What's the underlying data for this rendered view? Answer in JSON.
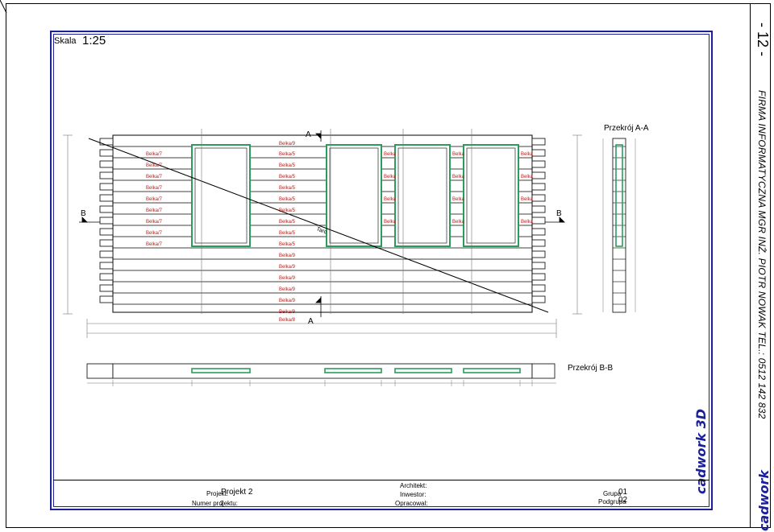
{
  "sheet": {
    "scale_label": "Skala",
    "scale_value": "1:25",
    "sheet_number": "- 12 -",
    "firm_info": "FIRMA INFORMATYCZNA MGR INŻ. PIOTR NOWAK  TEL.: 0512 142 832",
    "logo_text": "cadwork 3D",
    "logo_side_text": "cadwork"
  },
  "drawing": {
    "section_a_marker": "A",
    "section_b_marker": "B",
    "section_aa_title": "Przekrój A-A",
    "section_bb_title": "Przekrój B-B",
    "beam_labels_left": [
      "Belka/7",
      "Belka/7",
      "Belka/7",
      "Belka/7",
      "Belka/7",
      "Belka/7",
      "Belka/7",
      "Belka/7",
      "Belka/7"
    ],
    "beam_labels_center": [
      "Belka/9",
      "Belka/5",
      "Belka/5",
      "Belka/5",
      "Belka/5",
      "Belka/5",
      "Belka/5",
      "Belka/5",
      "Belka/5",
      "Belka/5",
      "Belka/9",
      "Belka/9",
      "Belka/9",
      "Belka/9",
      "Belka/9",
      "Belka/9",
      "Belka/8"
    ],
    "beam_label_small": "Belka",
    "diagonal_label": "Tarc"
  },
  "title_block": {
    "project_label": "Projekt:",
    "project_value": "Projekt 2",
    "project_number_label": "Numer projektu:",
    "project_number_value": "2",
    "architect_label": "Architekt:",
    "investor_label": "Inwestor:",
    "prepared_label": "Opracowal:",
    "group_label": "Grupa",
    "group_value": "01",
    "subgroup_label": "Podgrupa",
    "subgroup_value": "02"
  }
}
